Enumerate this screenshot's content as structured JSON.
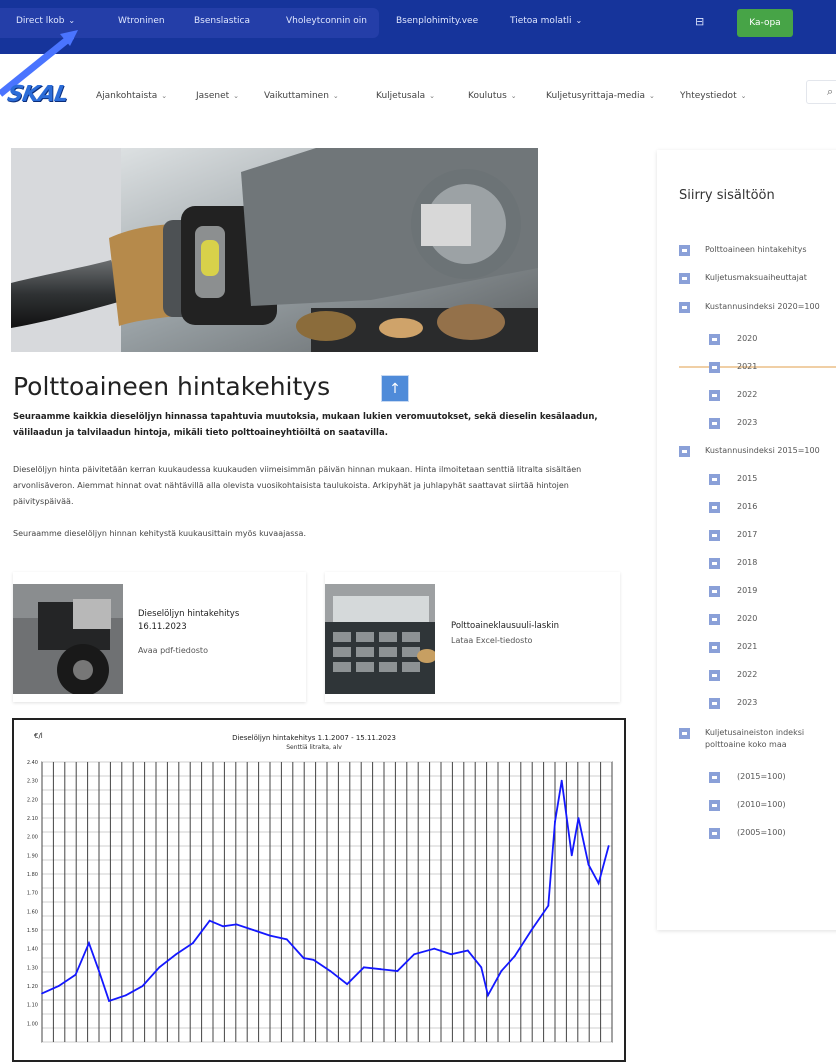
{
  "topbar": {
    "links": [
      {
        "label": "Direct lkob",
        "chevron": true
      },
      {
        "label": "Wtroninen",
        "chevron": false
      },
      {
        "label": "Bsenslastica",
        "chevron": false
      },
      {
        "label": "Vholeytconnin oin",
        "chevron": false
      },
      {
        "label": "Bsenplohimity.vee",
        "chevron": false
      },
      {
        "label": "Tietoa molatli",
        "chevron": true
      }
    ],
    "cart_icon": "cart-icon",
    "green_button_label": "Ka-opa",
    "colors": {
      "bar": "#16349b",
      "group": "#243ea8",
      "green": "#47a447"
    }
  },
  "logo": {
    "text": "SKAL"
  },
  "mainnav": {
    "items": [
      {
        "label": "Ajankohtaista",
        "chevron": true
      },
      {
        "label": "Jasenet",
        "chevron": true
      },
      {
        "label": "Vaikuttaminen",
        "chevron": true
      },
      {
        "label": "Kuljetusala",
        "chevron": true
      },
      {
        "label": "Koulutus",
        "chevron": true
      },
      {
        "label": "Kuljetusyrittaja-media",
        "chevron": true
      },
      {
        "label": "Yhteystiedot",
        "chevron": true
      }
    ],
    "search_icon": "search-icon"
  },
  "article": {
    "title": "Polttoaineen hintakehitys",
    "lead": "Seuraamme kaikkia dieselöljyn hinnassa tapahtuvia muutoksia, mukaan lukien veromuutokset, sekä dieselin kesälaadun, välilaadun ja talvilaadun hintoja, mikäli tieto polttoaineyhtiöiltä on saatavilla.",
    "body": "Dieselöljyn hinta päivitetään kerran kuukaudessa kuukauden viimeisimmän päivän hinnan mukaan. Hinta ilmoitetaan senttiä litralta sisältäen arvonlisäveron. Aiemmat hinnat ovat nähtävillä alla olevista vuosikohtaisista taulukoista. Arkipyhät ja juhlapyhät saattavat siirtää hintojen päivityspäivää.",
    "note": "Seuraamme dieselöljyn hinnan kehitystä kuukausittain myös kuvaajassa.",
    "up_icon": "arrow-up-icon"
  },
  "cards": [
    {
      "title": "Dieselöljyn hintakehitys 16.11.2023",
      "meta": "Avaa pdf-tiedosto"
    },
    {
      "title": "Polttoaineklausuuli-laskin",
      "meta": "Lataa Excel-tiedosto"
    }
  ],
  "sidebar": {
    "title": "Siirry sisältöön",
    "items": [
      {
        "label": "Polttoaineen hintakehitys",
        "level": 0
      },
      {
        "label": "Kuljetusmaksuaiheuttajat",
        "level": 0
      },
      {
        "label": "Kustannusindeksi 2020=100",
        "level": 0
      },
      {
        "label": "2020",
        "level": 1
      },
      {
        "label": "2021",
        "level": 1
      },
      {
        "label": "2022",
        "level": 1
      },
      {
        "label": "2023",
        "level": 1
      },
      {
        "label": "Kustannusindeksi 2015=100",
        "level": 0
      },
      {
        "label": "2015",
        "level": 1
      },
      {
        "label": "2016",
        "level": 1
      },
      {
        "label": "2017",
        "level": 1
      },
      {
        "label": "2018",
        "level": 1
      },
      {
        "label": "2019",
        "level": 1
      },
      {
        "label": "2020",
        "level": 1
      },
      {
        "label": "2021",
        "level": 1
      },
      {
        "label": "2022",
        "level": 1
      },
      {
        "label": "2023",
        "level": 1
      },
      {
        "label": "Kuljetusaineiston indeksi polttoaine koko maa",
        "level": 0
      },
      {
        "label": "(2015=100)",
        "level": 1
      },
      {
        "label": "(2010=100)",
        "level": 1
      },
      {
        "label": "(2005=100)",
        "level": 1
      }
    ]
  },
  "chart_data": {
    "type": "line",
    "title": "Dieselöljyn hintakehitys 1.1.2007 - 15.11.2023",
    "subtitle": "Senttiä litralta, alv",
    "ylabel": "€/l",
    "ylim": [
      0.9,
      2.4
    ],
    "yticks": [
      2.4,
      2.3,
      2.2,
      2.1,
      2.0,
      1.9,
      1.8,
      1.7,
      1.6,
      1.5,
      1.4,
      1.3,
      1.2,
      1.1,
      1.0
    ],
    "x": [
      2007,
      2007.5,
      2008,
      2008.4,
      2008.7,
      2009,
      2009.5,
      2010,
      2010.5,
      2011,
      2011.5,
      2012,
      2012.4,
      2012.8,
      2013.3,
      2013.8,
      2014.3,
      2014.8,
      2015.1,
      2015.6,
      2016.1,
      2016.6,
      2017.1,
      2017.6,
      2018.1,
      2018.7,
      2019.2,
      2019.7,
      2020.1,
      2020.3,
      2020.7,
      2021.1,
      2021.6,
      2022.1,
      2022.3,
      2022.5,
      2022.8,
      2023.0,
      2023.3,
      2023.6,
      2023.9
    ],
    "values": [
      1.16,
      1.2,
      1.26,
      1.43,
      1.28,
      1.12,
      1.15,
      1.2,
      1.3,
      1.37,
      1.43,
      1.55,
      1.52,
      1.53,
      1.5,
      1.47,
      1.45,
      1.35,
      1.34,
      1.28,
      1.21,
      1.3,
      1.29,
      1.28,
      1.37,
      1.4,
      1.37,
      1.39,
      1.3,
      1.15,
      1.28,
      1.36,
      1.5,
      1.63,
      2.08,
      2.3,
      1.9,
      2.1,
      1.85,
      1.75,
      1.95
    ],
    "grid": true
  }
}
